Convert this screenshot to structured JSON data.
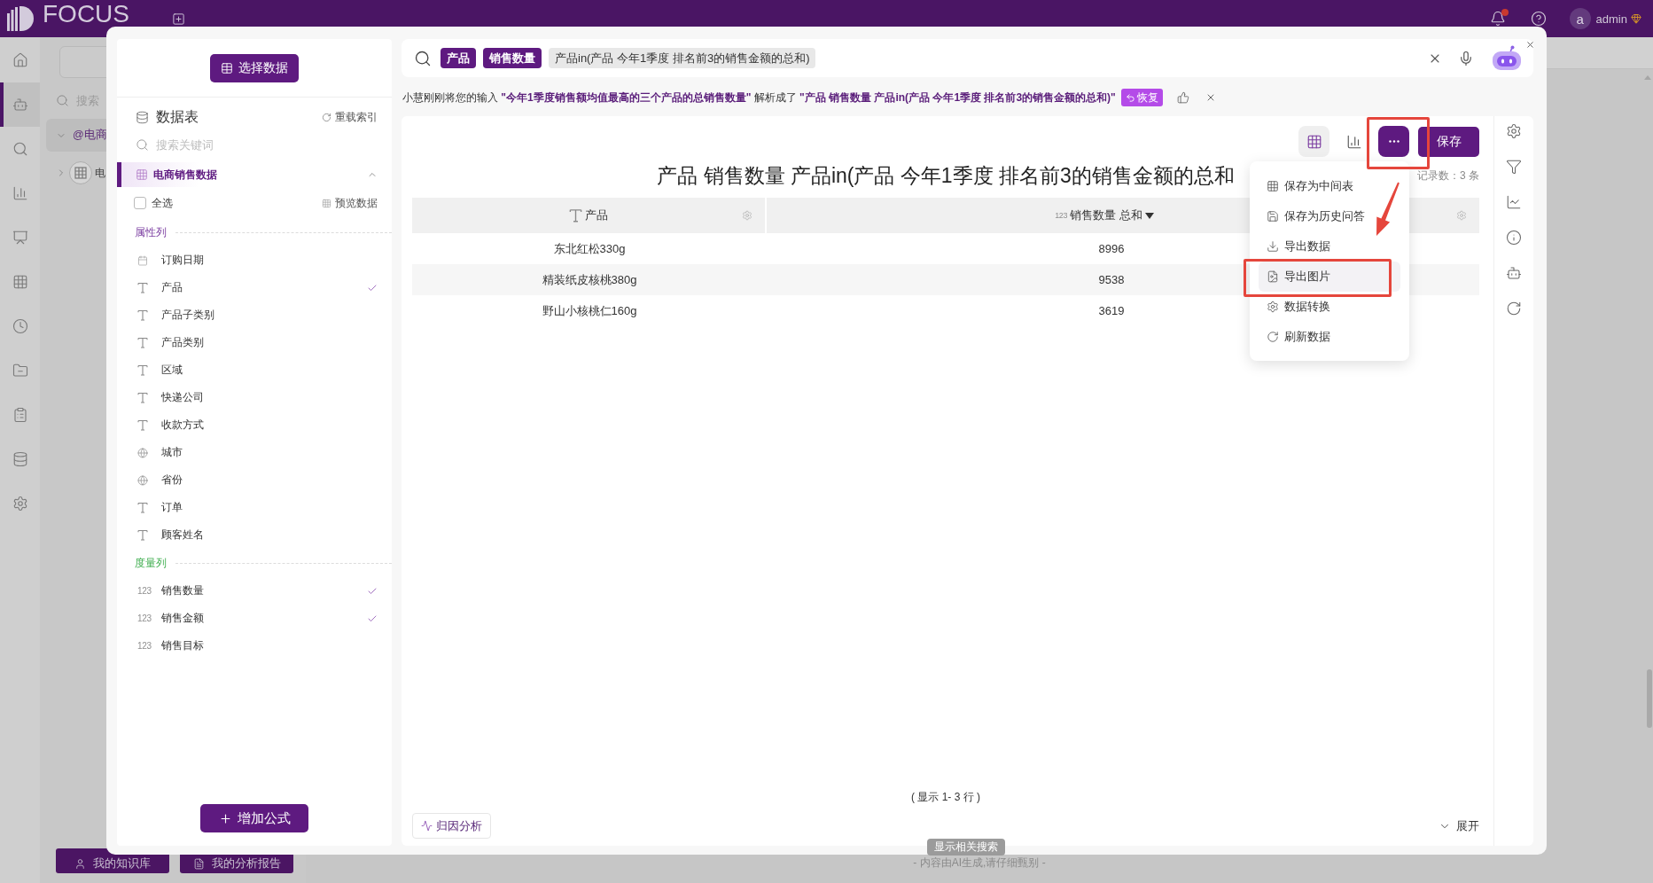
{
  "topbar": {
    "logo": "FOCUS",
    "unread": true,
    "user": {
      "avatar": "a",
      "name": "admin"
    }
  },
  "nav": [
    {
      "selected": false
    },
    {
      "selected": true
    },
    {
      "selected": false
    },
    {
      "selected": false
    },
    {
      "selected": false
    },
    {
      "selected": false
    },
    {
      "selected": false
    },
    {
      "selected": false
    },
    {
      "selected": false
    },
    {
      "selected": false
    },
    {
      "selected": false
    }
  ],
  "explorer": {
    "search_placeholder": "搜索",
    "tree": [
      {
        "kind": "group",
        "label": "@电商",
        "expanded": true,
        "selected": true
      },
      {
        "kind": "table",
        "label": "电",
        "expanded": false,
        "selected": false
      }
    ],
    "buttons": [
      "我的知识库",
      "我的分析报告"
    ]
  },
  "disclaimer": "- 内容由AI生成,请仔细甄别 -",
  "dialog": {
    "data_panel": {
      "select_button": "选择数据",
      "title": "数据表",
      "reload": "重载索引",
      "search_placeholder": "搜索关键词",
      "table": {
        "name": "电商销售数据",
        "expanded": true
      },
      "select_all": {
        "label": "全选",
        "checked": false
      },
      "preview": "预览数据",
      "groups": [
        {
          "kind": "attribute",
          "title": "属性列",
          "columns": [
            {
              "name": "订购日期",
              "kind": "date",
              "checked": false
            },
            {
              "name": "产品",
              "kind": "text",
              "checked": true
            },
            {
              "name": "产品子类别",
              "kind": "text",
              "checked": false
            },
            {
              "name": "产品类别",
              "kind": "text",
              "checked": false
            },
            {
              "name": "区域",
              "kind": "text",
              "checked": false
            },
            {
              "name": "快递公司",
              "kind": "text",
              "checked": false
            },
            {
              "name": "收款方式",
              "kind": "text",
              "checked": false
            },
            {
              "name": "城市",
              "kind": "geo",
              "checked": false
            },
            {
              "name": "省份",
              "kind": "geo",
              "checked": false
            },
            {
              "name": "订单",
              "kind": "text",
              "checked": false
            },
            {
              "name": "顾客姓名",
              "kind": "text",
              "checked": false
            }
          ]
        },
        {
          "kind": "measure",
          "title": "度量列",
          "columns": [
            {
              "name": "销售数量",
              "kind": "number",
              "type_label": "123",
              "checked": true
            },
            {
              "name": "销售金额",
              "kind": "number",
              "type_label": "123",
              "checked": true
            },
            {
              "name": "销售目标",
              "kind": "number",
              "type_label": "123",
              "checked": false
            }
          ]
        }
      ],
      "add_formula": "增加公式"
    },
    "search": {
      "tokens": [
        {
          "kind": "column",
          "text": "产品"
        },
        {
          "kind": "column",
          "text": "销售数量"
        },
        {
          "kind": "condition",
          "text": "产品in(产品 今年1季度 排名前3的销售金额的总和)"
        }
      ]
    },
    "notice": {
      "text": "小慧刚刚将您的输入 **\"今年1季度销售额均值最高的三个产品的总销售数量\"** 解析成了 **\"产品 销售数量 产品in(产品 今年1季度 排名前3的销售金额的总和)\"**",
      "restore": "恢复"
    },
    "result": {
      "views": [
        {
          "kind": "table",
          "selected": true
        },
        {
          "kind": "chart",
          "selected": false
        }
      ],
      "save": "保存",
      "title": "产品 销售数量 产品in(产品 今年1季度 排名前3的销售金额的总和",
      "record_count": "记录数：3 条",
      "table": {
        "columns": [
          {
            "label": "产品",
            "kind": "text",
            "sort_desc": false
          },
          {
            "label": "销售数量 总和",
            "kind": "number",
            "type_label": "123",
            "sort_desc": true
          }
        ],
        "rows": [
          [
            "东北红松330g",
            "8996"
          ],
          [
            "精装纸皮核桃380g",
            "9538"
          ],
          [
            "野山小核桃仁160g",
            "3619"
          ]
        ]
      },
      "pagination": "( 显示 1- 3 行 )",
      "attribution": "归因分析",
      "expand": "展开",
      "menu": [
        {
          "label": "保存为中间表",
          "highlighted": false
        },
        {
          "label": "保存为历史问答",
          "highlighted": false
        },
        {
          "label": "导出数据",
          "highlighted": false
        },
        {
          "label": "导出图片",
          "highlighted": true
        },
        {
          "label": "数据转换",
          "highlighted": false
        },
        {
          "label": "刷新数据",
          "highlighted": false
        }
      ]
    }
  },
  "related_search": "显示相关搜索",
  "annotations": [
    {
      "kind": "frame"
    },
    {
      "kind": "arrow"
    },
    {
      "kind": "frame"
    }
  ]
}
